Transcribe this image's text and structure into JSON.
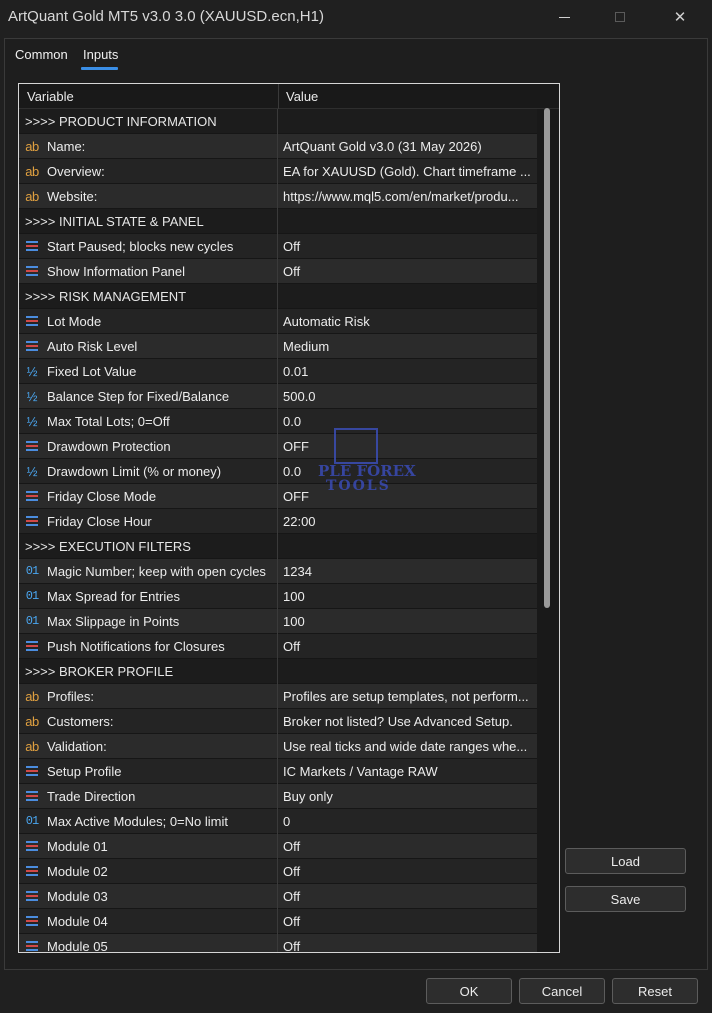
{
  "window": {
    "title": "ArtQuant Gold MT5 v3.0 3.0 (XAUUSD.ecn,H1)",
    "close_glyph": "✕"
  },
  "tabs": [
    {
      "label": "Common"
    },
    {
      "label": "Inputs"
    }
  ],
  "grid": {
    "header_variable": "Variable",
    "header_value": "Value",
    "rows": [
      {
        "type": "section",
        "label": ">>>> PRODUCT INFORMATION",
        "value": ""
      },
      {
        "type": "string",
        "label": "Name:",
        "value": "ArtQuant Gold v3.0 (31 May 2026)"
      },
      {
        "type": "string",
        "label": "Overview:",
        "value": "EA for XAUUSD (Gold). Chart timeframe ..."
      },
      {
        "type": "string",
        "label": "Website:",
        "value": "https://www.mql5.com/en/market/produ..."
      },
      {
        "type": "section",
        "label": ">>>> INITIAL STATE & PANEL",
        "value": ""
      },
      {
        "type": "enum",
        "label": "Start Paused; blocks new cycles",
        "value": "Off"
      },
      {
        "type": "enum",
        "label": "Show Information Panel",
        "value": "Off"
      },
      {
        "type": "section",
        "label": ">>>> RISK MANAGEMENT",
        "value": ""
      },
      {
        "type": "enum",
        "label": "Lot Mode",
        "value": "Automatic Risk"
      },
      {
        "type": "enum",
        "label": "Auto Risk Level",
        "value": "Medium"
      },
      {
        "type": "double",
        "label": "Fixed Lot Value",
        "value": "0.01"
      },
      {
        "type": "double",
        "label": "Balance Step for Fixed/Balance",
        "value": "500.0"
      },
      {
        "type": "double",
        "label": "Max Total Lots; 0=Off",
        "value": "0.0"
      },
      {
        "type": "enum",
        "label": "Drawdown Protection",
        "value": "OFF"
      },
      {
        "type": "double",
        "label": "Drawdown Limit (% or money)",
        "value": "0.0"
      },
      {
        "type": "enum",
        "label": "Friday Close Mode",
        "value": "OFF"
      },
      {
        "type": "enum",
        "label": "Friday Close Hour",
        "value": "22:00"
      },
      {
        "type": "section",
        "label": ">>>> EXECUTION FILTERS",
        "value": ""
      },
      {
        "type": "int",
        "label": "Magic Number; keep with open cycles",
        "value": "1234"
      },
      {
        "type": "int",
        "label": "Max Spread for Entries",
        "value": "100"
      },
      {
        "type": "int",
        "label": "Max Slippage in Points",
        "value": "100"
      },
      {
        "type": "enum",
        "label": "Push Notifications for Closures",
        "value": "Off"
      },
      {
        "type": "section",
        "label": ">>>> BROKER PROFILE",
        "value": ""
      },
      {
        "type": "string",
        "label": "Profiles:",
        "value": "Profiles are setup templates, not perform..."
      },
      {
        "type": "string",
        "label": "Customers:",
        "value": "Broker not listed? Use Advanced Setup."
      },
      {
        "type": "string",
        "label": "Validation:",
        "value": "Use real ticks and wide date ranges whe..."
      },
      {
        "type": "enum",
        "label": "Setup Profile",
        "value": "IC Markets / Vantage RAW"
      },
      {
        "type": "enum",
        "label": "Trade Direction",
        "value": "Buy only"
      },
      {
        "type": "int",
        "label": "Max Active Modules; 0=No limit",
        "value": "0"
      },
      {
        "type": "enum",
        "label": "Module 01",
        "value": "Off"
      },
      {
        "type": "enum",
        "label": "Module 02",
        "value": "Off"
      },
      {
        "type": "enum",
        "label": "Module 03",
        "value": "Off"
      },
      {
        "type": "enum",
        "label": "Module 04",
        "value": "Off"
      },
      {
        "type": "enum",
        "label": "Module 05",
        "value": "Off"
      }
    ]
  },
  "icons": {
    "string": {
      "glyph": "ab",
      "name": "string-type-icon"
    },
    "int": {
      "glyph": "01",
      "name": "integer-type-icon"
    },
    "double": {
      "glyph": "½",
      "name": "double-type-icon"
    },
    "enum": {
      "glyph": "",
      "name": "enum-type-icon"
    }
  },
  "watermark": {
    "line1": "PLE FOREX",
    "line2": "TOOLS"
  },
  "side_buttons": {
    "load": "Load",
    "save": "Save"
  },
  "bottom_buttons": {
    "ok": "OK",
    "cancel": "Cancel",
    "reset": "Reset"
  },
  "colors": {
    "accent_tab_underline": "#3a8ee6",
    "string_icon": "#e0a040",
    "numeric_icon": "#4aa6f0",
    "enum_icon_blue": "#4b8de0",
    "enum_icon_red": "#d04848"
  }
}
